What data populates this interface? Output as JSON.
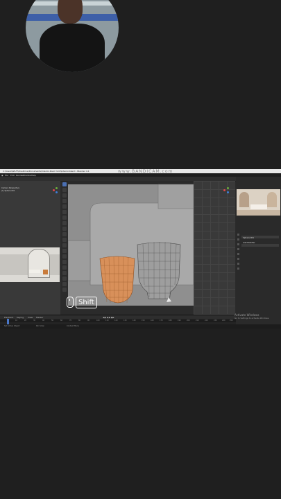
{
  "window": {
    "title": "C:\\Users\\WILFI\\OneDrive\\Documents\\Interior-Room Unit\\Interior.blend - Blender 4.1",
    "watermark": "www.BANDICAM.com"
  },
  "menu": [
    "File",
    "Edit",
    "Render",
    "Window",
    "Help"
  ],
  "workspace_tabs": [
    {
      "label": "Layout",
      "active": true
    },
    {
      "label": "Modeling",
      "active": false
    },
    {
      "label": "Sculpting",
      "active": false
    },
    {
      "label": "UV Editing",
      "active": false
    },
    {
      "label": "Texture Paint",
      "active": false
    },
    {
      "label": "Shading",
      "active": false
    },
    {
      "label": "Animation",
      "active": false
    },
    {
      "label": "Rendering",
      "active": false
    },
    {
      "label": "Compositing",
      "active": false
    },
    {
      "label": "Geometry Nodes",
      "active": false
    },
    {
      "label": "Scripting",
      "active": false
    }
  ],
  "left_viewport": {
    "line1": "Camera Perspective",
    "line2": "(1) Sphere.001"
  },
  "timeline": {
    "menu": [
      "Playback",
      "Keying",
      "View",
      "Marker"
    ],
    "ruler": [
      "0",
      "10",
      "20",
      "30",
      "40",
      "50",
      "60",
      "70",
      "80",
      "90",
      "100",
      "110",
      "120",
      "130",
      "140",
      "150",
      "160",
      "170",
      "180",
      "190",
      "200",
      "210",
      "220",
      "230",
      "240",
      "250"
    ]
  },
  "status": {
    "left": "Set Active Object",
    "mid": "Pan View",
    "right": "Context Menu"
  },
  "properties": {
    "object_name": "Sphere.001",
    "section": "Add Modifier"
  },
  "windows_activation": {
    "title": "Activate Windows",
    "subtitle": "Go to Settings to activate Windows."
  },
  "overlay": {
    "key_label": "Shift"
  },
  "colors": {
    "accent": "#4a77c9",
    "selected_object": "#d8905a",
    "background": "#1f1f1f"
  }
}
